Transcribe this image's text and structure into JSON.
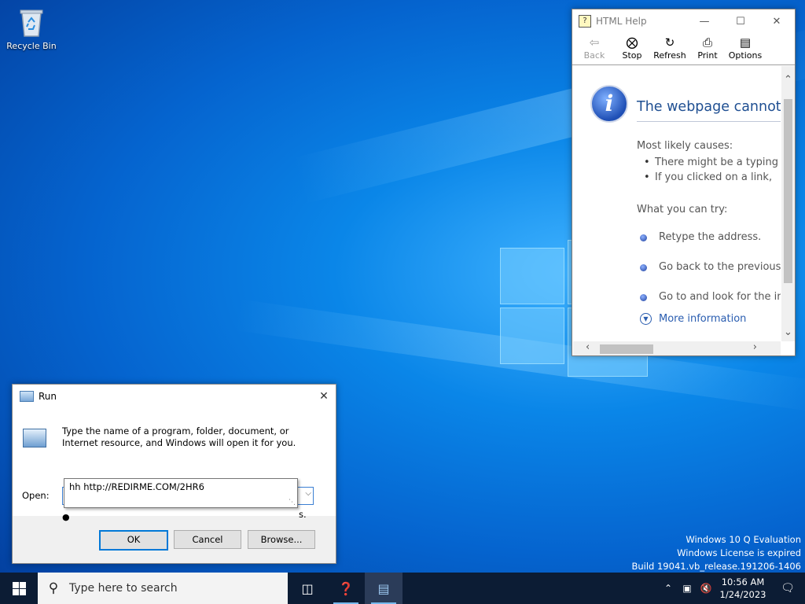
{
  "desktop": {
    "icons": [
      {
        "label": "Recycle Bin",
        "icon": "recycle-bin-icon"
      }
    ],
    "watermark": {
      "line1": "Windows 10 Q Evaluation",
      "line2": "Windows License is expired",
      "line3": "Build 19041.vb_release.191206-1406"
    }
  },
  "help_window": {
    "title": "HTML Help",
    "toolbar": [
      {
        "label": "Back",
        "icon": "back-arrow-icon",
        "enabled": false
      },
      {
        "label": "Stop",
        "icon": "stop-icon",
        "enabled": true
      },
      {
        "label": "Refresh",
        "icon": "refresh-icon",
        "enabled": true
      },
      {
        "label": "Print",
        "icon": "printer-icon",
        "enabled": true
      },
      {
        "label": "Options",
        "icon": "options-icon",
        "enabled": true
      }
    ],
    "content": {
      "heading": "The webpage cannot be",
      "causes_title": "Most likely causes:",
      "causes": [
        "There might be a typing",
        "If you clicked on a link,"
      ],
      "try_title": "What you can try:",
      "try_items": [
        "Retype the address.",
        "Go back to the previous p",
        "Go to  and look for the in"
      ],
      "more_info": "More information"
    }
  },
  "run_dialog": {
    "title": "Run",
    "description": "Type the name of a program, folder, document, or Internet resource, and Windows will open it for you.",
    "open_label": "Open:",
    "open_value": "hh http://REDIRME.C",
    "autocomplete": [
      "hh http://REDIRME.COM/2HR6"
    ],
    "hidden_text_fragment": "s.",
    "buttons": {
      "ok": "OK",
      "cancel": "Cancel",
      "browse": "Browse..."
    }
  },
  "taskbar": {
    "search_placeholder": "Type here to search",
    "clock_time": "10:56 AM",
    "clock_date": "1/24/2023"
  },
  "colors": {
    "accent": "#0078d7",
    "taskbar": "#0c1c34",
    "link": "#2a5db0"
  }
}
